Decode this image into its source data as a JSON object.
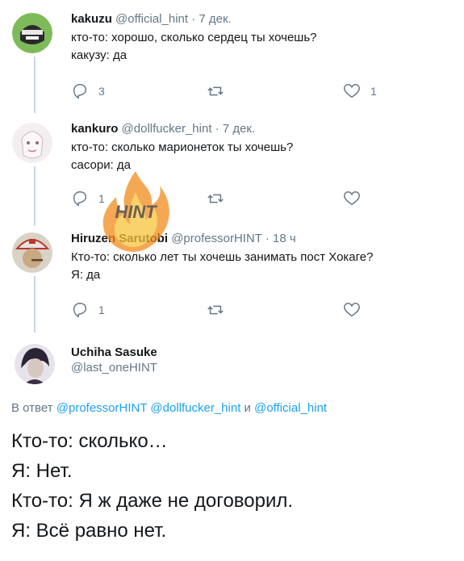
{
  "tweets": [
    {
      "name": "kakuzu",
      "handle": "@official_hint",
      "time": "7 дек.",
      "lines": [
        "кто-то: хорошо, сколько сердец ты хочешь?",
        "какузу: да"
      ],
      "reply_count": "3",
      "retweet_count": "",
      "like_count": "1"
    },
    {
      "name": "kankuro",
      "handle": "@dollfucker_hint",
      "time": "7 дек.",
      "lines": [
        "кто-то: сколько марионеток ты хочешь?",
        "сасори: да"
      ],
      "reply_count": "1",
      "retweet_count": "",
      "like_count": ""
    },
    {
      "name": "Hiruzen Sarutobi",
      "handle": "@professorHINT",
      "time": "18 ч",
      "lines": [
        "Кто-то: сколько лет ты хочешь занимать пост Хокаге?",
        "Я: да"
      ],
      "reply_count": "1",
      "retweet_count": "",
      "like_count": ""
    }
  ],
  "main": {
    "name": "Uchiha Sasuke",
    "handle": "@last_oneHINT",
    "reply_prefix": "В ответ",
    "mention1": "@professorHINT",
    "mention2": "@dollfucker_hint",
    "reply_and": "и",
    "mention3": "@official_hint",
    "lines": [
      "Кто-то: сколько…",
      "Я: Нет.",
      "Кто-то: Я ж даже не договорил.",
      "Я: Всё равно нет."
    ]
  },
  "watermark": {
    "text": "HINT",
    "colors": {
      "flame_outer": "#f28c1b",
      "flame_inner": "#f6c33a",
      "text": "#3a2a1a"
    }
  },
  "colors": {
    "text": "#14171a",
    "secondary": "#657786",
    "link": "#1da1f2",
    "thread": "#ccd6dd"
  },
  "icons": [
    "reply-icon",
    "retweet-icon",
    "like-icon"
  ]
}
